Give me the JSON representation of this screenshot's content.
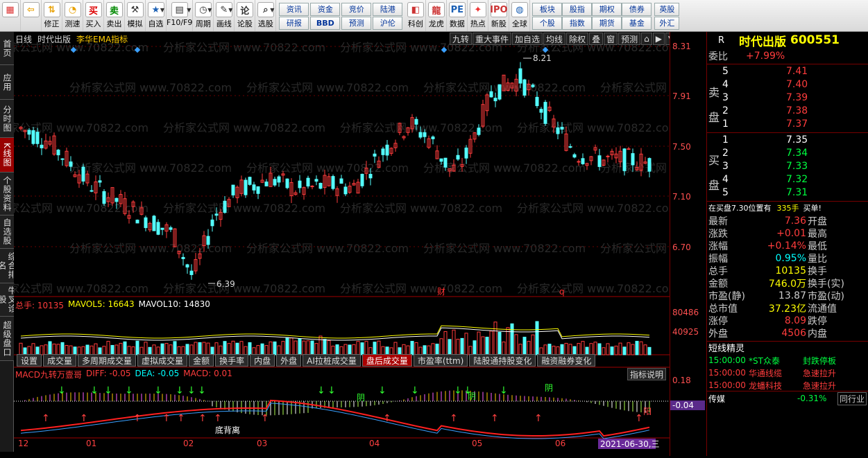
{
  "toolbar": {
    "buttons": [
      {
        "name": "logo",
        "label": "",
        "icon": "grid-logo-icon"
      },
      {
        "name": "back",
        "label": "",
        "icon": "back-arrow-icon"
      },
      {
        "name": "revise",
        "label": "修正",
        "icon": "up-down-arrow-icon"
      },
      {
        "name": "test",
        "label": "测速",
        "icon": "speed-icon"
      },
      {
        "name": "buy",
        "label": "买入",
        "icon": "buy-icon"
      },
      {
        "name": "sell",
        "label": "卖出",
        "icon": "sell-icon"
      },
      {
        "name": "simulate",
        "label": "模拟",
        "icon": "hammer-icon"
      },
      {
        "name": "watchlist",
        "label": "自选",
        "icon": "star-icon"
      },
      {
        "name": "f10",
        "label": "F10/F9",
        "icon": "f10-icon"
      },
      {
        "name": "period",
        "label": "周期",
        "icon": "clock-icon"
      },
      {
        "name": "draw",
        "label": "画线",
        "icon": "pencil-icon"
      },
      {
        "name": "argue",
        "label": "论股",
        "icon": "chat-icon"
      },
      {
        "name": "pick",
        "label": "选股",
        "icon": "search-icon"
      }
    ],
    "grid1": [
      "资讯",
      "资金",
      "竞价",
      "陆港",
      "研报",
      "BBD",
      "预测",
      "沪伦"
    ],
    "icons2": [
      {
        "name": "kechuang",
        "label": "科创",
        "icon": "chart-icon"
      },
      {
        "name": "longhu",
        "label": "龙虎",
        "icon": "dragon-icon"
      },
      {
        "name": "data",
        "label": "数据",
        "icon": "pe-icon"
      },
      {
        "name": "hot",
        "label": "热点",
        "icon": "fire-icon"
      },
      {
        "name": "newstock",
        "label": "新股",
        "icon": "ipo-icon"
      },
      {
        "name": "global",
        "label": "全球",
        "icon": "globe-icon"
      }
    ],
    "grid2": [
      "板块",
      "股指",
      "期权",
      "债券",
      "个股",
      "指数",
      "期货",
      "基金"
    ],
    "grid3": [
      "英股",
      "外汇"
    ]
  },
  "left_tabs": [
    "首页",
    "应用",
    "分时图",
    "K线图",
    "个股资料",
    "自选股",
    "综合排名",
    "牛叉诊股",
    "超级盘口"
  ],
  "chart": {
    "top_left_tags": [
      "日线",
      "时代出版",
      "李华EMA指标"
    ],
    "top_right_buttons": [
      "九转",
      "重大事件",
      "加自选",
      "均线",
      "除权",
      "叠",
      "窗",
      "预测"
    ],
    "price_scale": [
      "8.31",
      "7.91",
      "7.50",
      "7.10",
      "6.70"
    ],
    "high_label": "8.21",
    "low_label": "6.39",
    "event_marks": [
      "财",
      "q"
    ],
    "volume_header": {
      "total": "总手: 10135",
      "mavol5": "MAVOL5: 16643",
      "mavol10": "MAVOL10: 14830"
    },
    "volume_scale": [
      "80486",
      "40925"
    ],
    "bottom_tabs": [
      "设置",
      "成交量",
      "多周期成交量",
      "虚拟成交量",
      "金额",
      "换手率",
      "内盘",
      "外盘",
      "AI拉桩成交量",
      "盘后成交量",
      "市盈率(ttm)",
      "陆股通持股变化",
      "融资融券变化"
    ],
    "active_bottom_tab": "盘后成交量",
    "macd_header": {
      "title": "MACD九转万壹哥",
      "diff": "DIFF: -0.05",
      "dea": "DEA: -0.05",
      "macd": "MACD: 0.01"
    },
    "macd_button": "指标说明",
    "macd_scale": [
      "0.18",
      "-0.04"
    ],
    "macd_labels": [
      "底背离",
      "阴",
      "阴",
      "阳",
      "阴"
    ],
    "months": [
      "12",
      "01",
      "02",
      "03",
      "04",
      "05",
      "06"
    ],
    "date_tag": "2021-06-30,三"
  },
  "right_panel": {
    "header": {
      "letter": "R",
      "name": "时代出版",
      "code": "600551"
    },
    "weibi_label": "委比",
    "weibi_value": "+7.99%",
    "sell_label": "卖盘",
    "sell": [
      {
        "n": "5",
        "p": "7.41"
      },
      {
        "n": "4",
        "p": "7.40"
      },
      {
        "n": "3",
        "p": "7.39"
      },
      {
        "n": "2",
        "p": "7.38"
      },
      {
        "n": "1",
        "p": "7.37"
      }
    ],
    "buy_label": "买盘",
    "buy": [
      {
        "n": "1",
        "p": "7.35"
      },
      {
        "n": "2",
        "p": "7.34"
      },
      {
        "n": "3",
        "p": "7.33"
      },
      {
        "n": "4",
        "p": "7.32"
      },
      {
        "n": "5",
        "p": "7.31"
      }
    ],
    "ticker": {
      "text": "在买盘7.30位置有",
      "count": "335手",
      "action": "买单!"
    },
    "stats": [
      {
        "l": "最新",
        "v": "7.36",
        "r": "开盘"
      },
      {
        "l": "涨跌",
        "v": "+0.01",
        "r": "最高"
      },
      {
        "l": "涨幅",
        "v": "+0.14%",
        "r": "最低"
      },
      {
        "l": "振幅",
        "v": "0.95%",
        "r": "量比"
      },
      {
        "l": "总手",
        "v": "10135",
        "r": "换手"
      },
      {
        "l": "金额",
        "v": "746.0万",
        "r": "换手(实)"
      },
      {
        "l": "市盈(静)",
        "v": "13.87",
        "r": "市盈(动)"
      },
      {
        "l": "总市值",
        "v": "37.23亿",
        "r": "流通值"
      },
      {
        "l": "涨停",
        "v": "8.09",
        "r": "跌停"
      },
      {
        "l": "外盘",
        "v": "4506",
        "r": "内盘"
      }
    ],
    "short_title": "短线精灵",
    "short": [
      {
        "t": "15:00:00",
        "s": "*ST众泰",
        "e": "封跌停板",
        "c": "green"
      },
      {
        "t": "15:00:00",
        "s": "华通线缆",
        "e": "急速拉升",
        "c": "red"
      },
      {
        "t": "15:00:00",
        "s": "龙蟠科技",
        "e": "急速拉升",
        "c": "red"
      }
    ],
    "sector": {
      "name": "传媒",
      "pct": "-0.31%",
      "link": "同行业"
    }
  },
  "watermark": "分析家公式网 www.70822.com",
  "colors": {
    "up": "#ff3c3c",
    "down": "#54ffff",
    "axis": "#a00000"
  }
}
